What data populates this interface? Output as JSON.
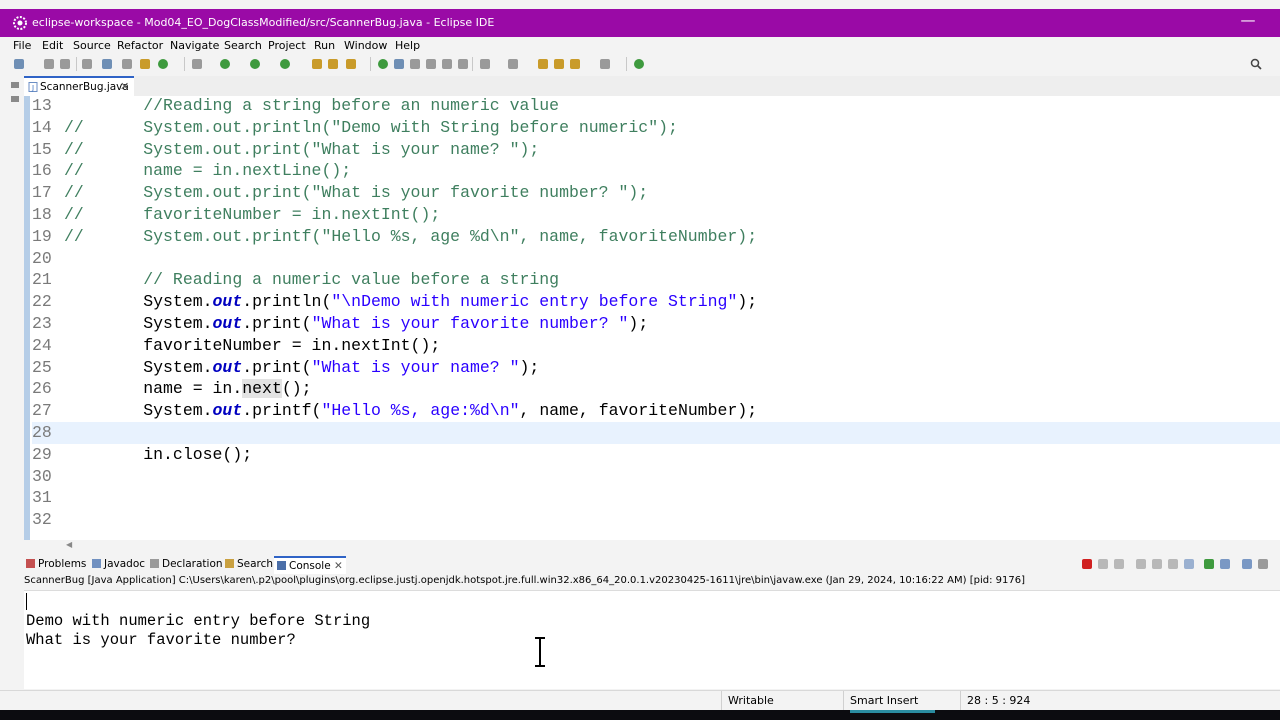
{
  "window": {
    "title": "eclipse-workspace - Mod04_EO_DogClassModified/src/ScannerBug.java - Eclipse IDE",
    "minimize_glyph": "—"
  },
  "menu": [
    "File",
    "Edit",
    "Source",
    "Refactor",
    "Navigate",
    "Search",
    "Project",
    "Run",
    "Window",
    "Help"
  ],
  "editor": {
    "tab_label": "ScannerBug.java",
    "tab_close": "✕",
    "current_line": 28,
    "lines": [
      {
        "n": "13",
        "text": "        //Reading a string before an numeric value"
      },
      {
        "n": "14",
        "text": "//      System.out.println(\"Demo with String before numeric\");"
      },
      {
        "n": "15",
        "text": "//      System.out.print(\"What is your name? \");"
      },
      {
        "n": "16",
        "text": "//      name = in.nextLine();"
      },
      {
        "n": "17",
        "text": "//      System.out.print(\"What is your favorite number? \");"
      },
      {
        "n": "18",
        "text": "//      favoriteNumber = in.nextInt();"
      },
      {
        "n": "19",
        "text": "//      System.out.printf(\"Hello %s, age %d\\n\", name, favoriteNumber);"
      },
      {
        "n": "20",
        "text": ""
      },
      {
        "n": "21",
        "text": "        // Reading a numeric value before a string"
      },
      {
        "n": "22",
        "text": "        System.out.println(\"\\nDemo with numeric entry before String\");"
      },
      {
        "n": "23",
        "text": "        System.out.print(\"What is your favorite number? \");"
      },
      {
        "n": "24",
        "text": "        favoriteNumber = in.nextInt();"
      },
      {
        "n": "25",
        "text": "        System.out.print(\"What is your name? \");"
      },
      {
        "n": "26",
        "text": "        name = in.next();"
      },
      {
        "n": "27",
        "text": "        System.out.printf(\"Hello %s, age:%d\\n\", name, favoriteNumber);"
      },
      {
        "n": "28",
        "text": ""
      },
      {
        "n": "29",
        "text": "        in.close();"
      },
      {
        "n": "30",
        "text": ""
      },
      {
        "n": "31",
        "text": ""
      },
      {
        "n": "32",
        "text": ""
      }
    ]
  },
  "bottom_tabs": [
    {
      "name": "problems",
      "label": "Problems",
      "active": false
    },
    {
      "name": "javadoc",
      "label": "Javadoc",
      "active": false
    },
    {
      "name": "declaration",
      "label": "Declaration",
      "active": false
    },
    {
      "name": "search",
      "label": "Search",
      "active": false
    },
    {
      "name": "console",
      "label": "Console",
      "active": true,
      "close": "✕"
    }
  ],
  "console": {
    "info": "ScannerBug [Java Application] C:\\Users\\karen\\.p2\\pool\\plugins\\org.eclipse.justj.openjdk.hotspot.jre.full.win32.x86_64_20.0.1.v20230425-1611\\jre\\bin\\javaw.exe  (Jan 29, 2024, 10:16:22 AM) [pid: 9176]",
    "output": [
      "",
      "Demo with numeric entry before String",
      "What is your favorite number?"
    ]
  },
  "status": {
    "writable": "Writable",
    "insert_mode": "Smart Insert",
    "position": "28 : 5 : 924"
  },
  "colors": {
    "titlebar": "#9a0aa6",
    "comment": "#3f7f5f",
    "string": "#2a00ff",
    "field": "#0000c0",
    "current_line": "#e8f2fe"
  }
}
